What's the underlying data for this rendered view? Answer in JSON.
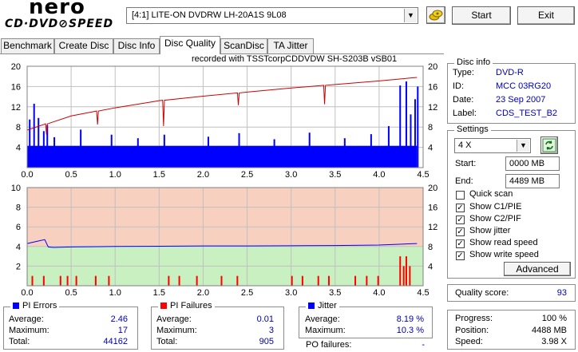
{
  "app": {
    "logo_main": "nero",
    "logo_sub": "CD·DVD⊘SPEED"
  },
  "drive": {
    "selected": "[4:1]  LITE-ON DVDRW LH-20A1S 9L08"
  },
  "toolbar": {
    "start_label": "Start",
    "exit_label": "Exit"
  },
  "tabs": [
    {
      "label": "Benchmark"
    },
    {
      "label": "Create Disc"
    },
    {
      "label": "Disc Info"
    },
    {
      "label": "Disc Quality",
      "active": true
    },
    {
      "label": "ScanDisc"
    },
    {
      "label": "TA Jitter"
    }
  ],
  "chart_header": "recorded with TSSTcorpCDDVDW SH-S203B  vSB01",
  "chart_data": [
    {
      "type": "bar",
      "name": "PI Errors",
      "x_ticks": [
        "0.0",
        "0.5",
        "1.0",
        "1.5",
        "2.0",
        "2.5",
        "3.0",
        "3.5",
        "4.0",
        "4.5"
      ],
      "xlim": [
        0,
        4.5
      ],
      "y_left_ticks": [
        "20",
        "16",
        "12",
        "8",
        "4"
      ],
      "y_right_ticks": [
        "20",
        "16",
        "12",
        "8",
        "4"
      ],
      "ylim": [
        0,
        20
      ],
      "series": [
        {
          "name": "PIE",
          "color": "#0000ff",
          "baseline": 4.3,
          "spikes": [
            [
              0.02,
              9.5
            ],
            [
              0.07,
              12.6
            ],
            [
              0.12,
              9.8
            ],
            [
              0.18,
              7.2
            ],
            [
              0.22,
              8.4
            ],
            [
              0.3,
              6
            ],
            [
              0.6,
              7.5
            ],
            [
              0.95,
              6.5
            ],
            [
              1.25,
              5.8
            ],
            [
              1.55,
              6.5
            ],
            [
              2.05,
              6.1
            ],
            [
              2.4,
              6.8
            ],
            [
              2.8,
              5.6
            ],
            [
              3.2,
              6.9
            ],
            [
              3.6,
              5.8
            ],
            [
              3.9,
              6.6
            ],
            [
              4.1,
              8.2
            ],
            [
              4.23,
              16.2
            ],
            [
              4.3,
              17
            ],
            [
              4.35,
              10.5
            ],
            [
              4.4,
              13.5
            ],
            [
              4.43,
              16
            ]
          ]
        },
        {
          "name": "Read speed",
          "color": "#d00000",
          "unit": "x",
          "points": [
            [
              0,
              7.4
            ],
            [
              0.5,
              10.2
            ],
            [
              1.0,
              11.8
            ],
            [
              1.5,
              13.2
            ],
            [
              2.0,
              14.1
            ],
            [
              2.5,
              14.9
            ],
            [
              3.0,
              15.7
            ],
            [
              3.5,
              16.4
            ],
            [
              4.0,
              17.1
            ],
            [
              4.43,
              17.8
            ]
          ],
          "dips": [
            [
              0.22,
              6.5
            ],
            [
              0.8,
              8.5
            ],
            [
              1.55,
              8.2
            ],
            [
              2.4,
              12.3
            ],
            [
              3.38,
              12.5
            ]
          ]
        }
      ]
    },
    {
      "type": "bar",
      "name": "PI Failures / Jitter",
      "x_ticks": [
        "0.0",
        "0.5",
        "1.0",
        "1.5",
        "2.0",
        "2.5",
        "3.0",
        "3.5",
        "4.0",
        "4.5"
      ],
      "xlim": [
        0,
        4.5
      ],
      "y_left_ticks": [
        "10",
        "8",
        "6",
        "4",
        "2"
      ],
      "y_right_ticks": [
        "20",
        "16",
        "12",
        "8",
        "4"
      ],
      "ylim": [
        0,
        10
      ],
      "series": [
        {
          "name": "PIF",
          "color": "#ff0000",
          "bars": [
            [
              0.05,
              1
            ],
            [
              0.18,
              1
            ],
            [
              0.37,
              1
            ],
            [
              0.45,
              1
            ],
            [
              0.55,
              1
            ],
            [
              0.77,
              1
            ],
            [
              0.92,
              1
            ],
            [
              1.6,
              1
            ],
            [
              1.72,
              1
            ],
            [
              1.92,
              1
            ],
            [
              2.2,
              1
            ],
            [
              2.38,
              1
            ],
            [
              3.0,
              1
            ],
            [
              3.12,
              1
            ],
            [
              3.3,
              1
            ],
            [
              3.42,
              1
            ],
            [
              3.72,
              1
            ],
            [
              3.85,
              1
            ],
            [
              3.98,
              1
            ],
            [
              4.23,
              3
            ],
            [
              4.27,
              2
            ],
            [
              4.3,
              3
            ],
            [
              4.34,
              2
            ]
          ]
        },
        {
          "name": "Jitter",
          "color": "#0000ff",
          "unit": "%",
          "points": [
            [
              0,
              8.6
            ],
            [
              0.1,
              9.0
            ],
            [
              0.2,
              9.4
            ],
            [
              0.24,
              7.9
            ],
            [
              0.3,
              7.8
            ],
            [
              0.5,
              7.9
            ],
            [
              1.0,
              8.0
            ],
            [
              1.5,
              8.05
            ],
            [
              2.0,
              8.1
            ],
            [
              2.5,
              8.1
            ],
            [
              3.0,
              8.15
            ],
            [
              3.5,
              8.2
            ],
            [
              4.0,
              8.3
            ],
            [
              4.43,
              8.6
            ]
          ]
        }
      ]
    }
  ],
  "disc_info": {
    "title": "Disc info",
    "type_label": "Type:",
    "type_value": "DVD-R",
    "id_label": "ID:",
    "id_value": "MCC 03RG20",
    "date_label": "Date:",
    "date_value": "23 Sep 2007",
    "label_label": "Label:",
    "label_value": "CDS_TEST_B2"
  },
  "settings": {
    "title": "Settings",
    "speed": "4 X",
    "start_label": "Start:",
    "start_value": "0000 MB",
    "end_label": "End:",
    "end_value": "4489 MB",
    "options": [
      {
        "label": "Quick scan",
        "checked": false
      },
      {
        "label": "Show C1/PIE",
        "checked": true
      },
      {
        "label": "Show C2/PIF",
        "checked": true
      },
      {
        "label": "Show jitter",
        "checked": true
      },
      {
        "label": "Show read speed",
        "checked": true
      },
      {
        "label": "Show write speed",
        "checked": true
      }
    ],
    "advanced_label": "Advanced"
  },
  "quality": {
    "label": "Quality score:",
    "value": "93"
  },
  "progress": {
    "progress_label": "Progress:",
    "progress_value": "100 %",
    "position_label": "Position:",
    "position_value": "4488 MB",
    "speed_label": "Speed:",
    "speed_value": "3.98 X"
  },
  "pi_errors": {
    "title": "PI Errors",
    "color": "#0000ff",
    "average_label": "Average:",
    "average_value": "2.46",
    "maximum_label": "Maximum:",
    "maximum_value": "17",
    "total_label": "Total:",
    "total_value": "44162"
  },
  "pi_failures": {
    "title": "PI Failures",
    "color": "#ff0000",
    "average_label": "Average:",
    "average_value": "0.01",
    "maximum_label": "Maximum:",
    "maximum_value": "3",
    "total_label": "Total:",
    "total_value": "905"
  },
  "jitter": {
    "title": "Jitter",
    "color": "#0000ff",
    "average_label": "Average:",
    "average_value": "8.19 %",
    "maximum_label": "Maximum:",
    "maximum_value": "10.3 %",
    "po_label": "PO failures:",
    "po_value": "-"
  }
}
